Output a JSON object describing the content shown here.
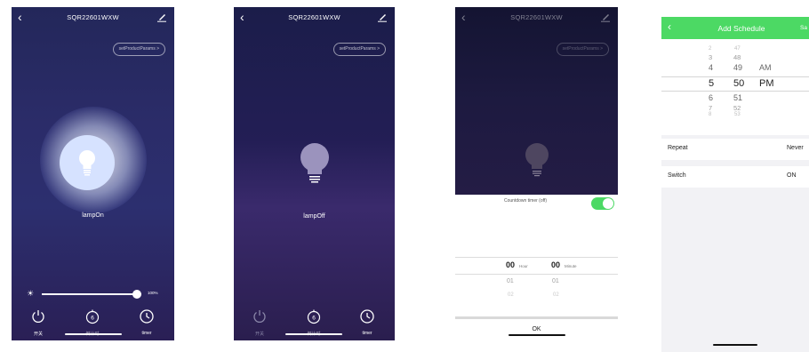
{
  "screen1": {
    "device_title": "SQR22601WXW",
    "params_button": "setProductParams >",
    "lamp_label": "lampOn",
    "brightness_percent": 100,
    "brightness_text": "100%",
    "tabs": [
      {
        "label": "开关",
        "icon": "power-icon"
      },
      {
        "label": "倒计时",
        "icon": "countdown-icon"
      },
      {
        "label": "timer",
        "icon": "clock-icon"
      }
    ]
  },
  "screen2": {
    "device_title": "SQR22601WXW",
    "params_button": "setProductParams >",
    "lamp_label": "lampOff",
    "tabs": [
      {
        "label": "开关",
        "icon": "power-icon"
      },
      {
        "label": "倒计时",
        "icon": "countdown-icon"
      },
      {
        "label": "timer",
        "icon": "clock-icon"
      }
    ]
  },
  "screen3": {
    "device_title": "SQR22601WXW",
    "params_button": "setProductParams >",
    "countdown_toggle_label": "Countdown timer (off)",
    "countdown_on": true,
    "hour_value": "00",
    "hour_unit": "Hour",
    "minute_value": "00",
    "minute_unit": "Minute",
    "hour_next": [
      "01",
      "02"
    ],
    "minute_next": [
      "01",
      "02"
    ],
    "ok_label": "OK"
  },
  "screen4": {
    "title": "Add Schedule",
    "save_label": "Sa",
    "time_picker": {
      "hours": [
        "2",
        "3",
        "4",
        "5",
        "6",
        "7",
        "8"
      ],
      "minutes": [
        "47",
        "48",
        "49",
        "50",
        "51",
        "52",
        "53"
      ],
      "ampm": [
        "AM",
        "PM"
      ],
      "selected_hour": "5",
      "selected_minute": "50",
      "selected_ampm": "PM"
    },
    "rows": [
      {
        "label": "Repeat",
        "value": "Never"
      },
      {
        "label": "Switch",
        "value": "ON"
      }
    ]
  }
}
